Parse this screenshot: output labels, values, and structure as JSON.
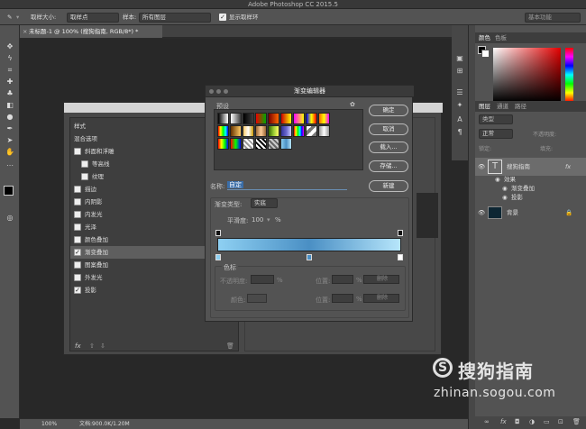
{
  "app": {
    "title": "Adobe Photoshop CC 2015.5"
  },
  "options_bar": {
    "sample_size_label": "取样大小:",
    "sample_size_value": "取样点",
    "sample_label": "样本:",
    "sample_value": "所有图层",
    "show_ring_label": "显示取样环",
    "workspace": "基本功能"
  },
  "document": {
    "tab_title": "未标题-1 @ 100% (搜狗指南, RGB/8*) *"
  },
  "status": {
    "zoom": "100%",
    "doc_size": "文档:900.0K/1.20M"
  },
  "color_panel": {
    "tab1": "颜色",
    "tab2": "色板"
  },
  "layers_panel": {
    "tabs": [
      "图层",
      "通道",
      "路径"
    ],
    "filter_kind": "类型",
    "blend_mode": "正常",
    "opacity_label": "不透明度:",
    "lock_label": "锁定:",
    "fill_label": "填充:",
    "layer_text_name": "搜狗指南",
    "effects_label": "效果",
    "effect1": "渐变叠加",
    "effect2": "投影",
    "layer_bg_name": "背景"
  },
  "layer_style": {
    "items": [
      {
        "label": "样式",
        "check": false,
        "plus": false,
        "indent": 0
      },
      {
        "label": "混合选项",
        "check": false,
        "plus": false,
        "indent": 0
      },
      {
        "label": "斜面和浮雕",
        "check": true,
        "checked": false,
        "plus": false,
        "indent": 0
      },
      {
        "label": "等高线",
        "check": true,
        "checked": false,
        "plus": false,
        "indent": 1
      },
      {
        "label": "纹理",
        "check": true,
        "checked": false,
        "plus": false,
        "indent": 1
      },
      {
        "label": "描边",
        "check": true,
        "checked": false,
        "plus": true,
        "indent": 0
      },
      {
        "label": "内阴影",
        "check": true,
        "checked": false,
        "plus": true,
        "indent": 0
      },
      {
        "label": "内发光",
        "check": true,
        "checked": false,
        "plus": false,
        "indent": 0
      },
      {
        "label": "光泽",
        "check": true,
        "checked": false,
        "plus": false,
        "indent": 0
      },
      {
        "label": "颜色叠加",
        "check": true,
        "checked": false,
        "plus": true,
        "indent": 0
      },
      {
        "label": "渐变叠加",
        "check": true,
        "checked": true,
        "plus": true,
        "indent": 0,
        "selected": true
      },
      {
        "label": "图案叠加",
        "check": true,
        "checked": false,
        "plus": false,
        "indent": 0
      },
      {
        "label": "外发光",
        "check": true,
        "checked": false,
        "plus": false,
        "indent": 0
      },
      {
        "label": "投影",
        "check": true,
        "checked": true,
        "plus": true,
        "indent": 0
      }
    ],
    "fx_label": "fx"
  },
  "gradient_editor": {
    "title": "渐变编辑器",
    "presets_label": "预设",
    "ok": "确定",
    "cancel": "取消",
    "load": "载入...",
    "save": "存储...",
    "name_label": "名称:",
    "name_value": "自定",
    "new": "新建",
    "type_label": "渐变类型:",
    "type_value": "实底",
    "smooth_label": "平滑度:",
    "smooth_value": "100",
    "smooth_unit": "%",
    "stops_label": "色标",
    "opacity_label": "不透明度:",
    "pct1": "%",
    "pos1": "位置:",
    "pct2": "%",
    "del1": "删除",
    "color_label": "颜色:",
    "pos2": "位置:",
    "pct3": "%",
    "del2": "删除",
    "gradient_start": "#8ed0f2",
    "gradient_mid": "#4a8fc4",
    "gradient_end": "#b7e6fb"
  },
  "watermark": {
    "brand": "搜狗指南",
    "url": "zhinan.sogou.com"
  }
}
